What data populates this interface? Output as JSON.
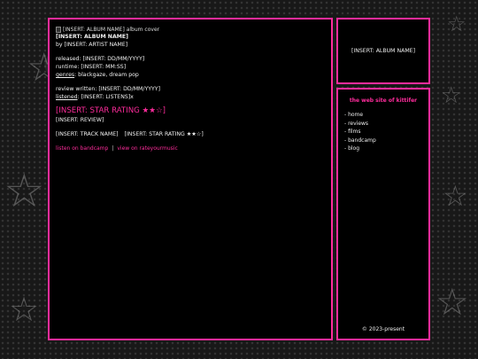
{
  "main": {
    "album_image_alt": "[INSERT: ALBUM NAME] album cover",
    "album_name": "[INSERT: ALBUM NAME]",
    "artist_line": "by [INSERT: ARTIST NAME]",
    "released": "released: [INSERT: DD/MM/YYYY]",
    "runtime": "runtime: [INSERT: MM:SS]",
    "genres_label": "genres",
    "genres_value": ": blackgaze, dream pop",
    "review_written": "review written: [INSERT: DD/MM/YYYY]",
    "listened_label": "listened",
    "listened_value": ": [INSERT: LISTENS]x",
    "star_rating": "[INSERT: STAR RATING ★★☆]",
    "review": "[INSERT: REVIEW]",
    "tracks": [
      {
        "name": "[INSERT: TRACK NAME]",
        "rating": "[INSERT: STAR RATING ★★☆]"
      }
    ],
    "links": {
      "bandcamp": "listen on bandcamp",
      "separator": "|",
      "rym": "view on rateyourmusic"
    }
  },
  "title_panel": {
    "album_name": "[INSERT: ALBUM NAME]"
  },
  "nav": {
    "site_title": "the web site of kittifer",
    "items": [
      {
        "label": "- home"
      },
      {
        "label": "- reviews"
      },
      {
        "label": "- films"
      },
      {
        "label": "- bandcamp"
      },
      {
        "label": "- blog"
      }
    ],
    "footer": "© 2023-present"
  },
  "colors": {
    "accent": "#ff2c9c",
    "panel_bg": "#000000"
  }
}
